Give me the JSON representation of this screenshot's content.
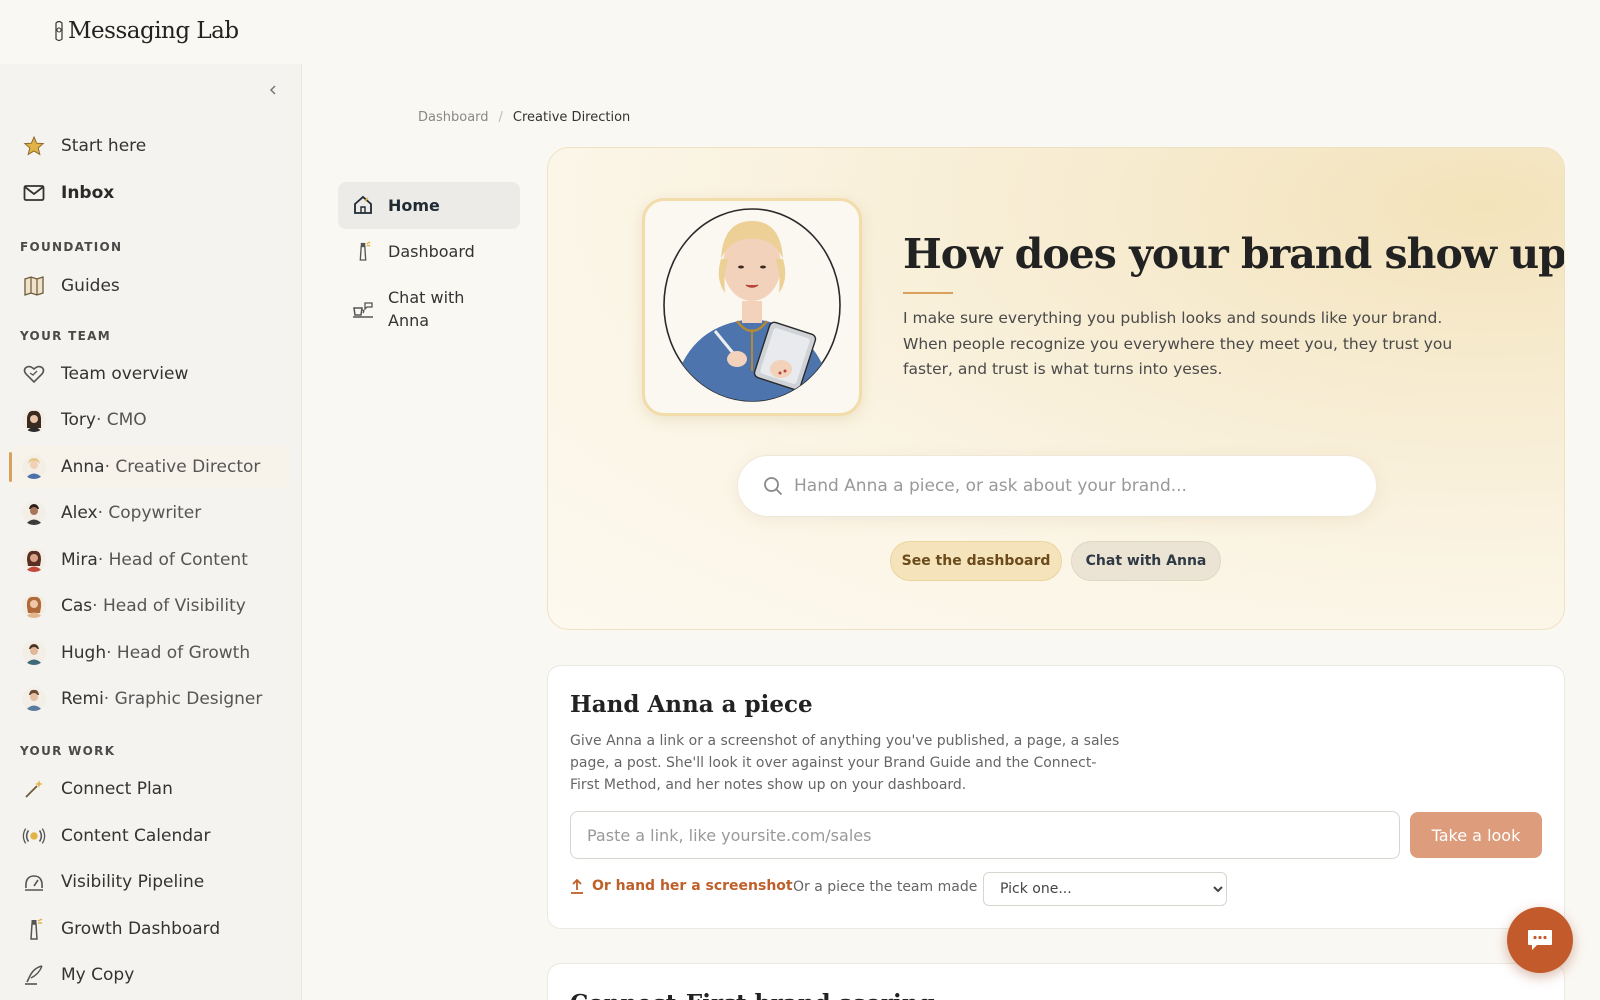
{
  "app": {
    "title": "Messaging Lab"
  },
  "sidebar": {
    "collapse_icon": "chevron-left-icon",
    "top_items": [
      {
        "label": "Start here",
        "icon": "star-icon"
      },
      {
        "label": "Inbox",
        "icon": "envelope-icon"
      }
    ],
    "sections": [
      {
        "title": "FOUNDATION",
        "items": [
          {
            "label": "Guides",
            "icon": "map-icon"
          }
        ]
      },
      {
        "title": "YOUR TEAM",
        "items": [
          {
            "label": "Team overview",
            "icon": "heart-outline-icon"
          },
          {
            "name": "Tory",
            "role": " · CMO",
            "icon": "tory-avatar"
          },
          {
            "name": "Anna",
            "role": " · Creative Director",
            "icon": "anna-avatar",
            "active": true
          },
          {
            "name": "Alex",
            "role": " · Copywriter",
            "icon": "alex-avatar"
          },
          {
            "name": "Mira",
            "role": " · Head of Content",
            "icon": "mira-avatar"
          },
          {
            "name": "Cas",
            "role": " · Head of Visibility",
            "icon": "cas-avatar"
          },
          {
            "name": "Hugh",
            "role": " · Head of Growth",
            "icon": "hugh-avatar"
          },
          {
            "name": "Remi",
            "role": " · Graphic Designer",
            "icon": "remi-avatar"
          }
        ]
      },
      {
        "title": "YOUR WORK",
        "items": [
          {
            "label": "Connect Plan",
            "icon": "sparkle-wand-icon"
          },
          {
            "label": "Content Calendar",
            "icon": "broadcast-icon"
          },
          {
            "label": "Visibility Pipeline",
            "icon": "gauge-icon"
          },
          {
            "label": "Growth Dashboard",
            "icon": "lighthouse-icon"
          },
          {
            "label": "My Copy",
            "icon": "quill-icon"
          }
        ]
      }
    ]
  },
  "breadcrumb": {
    "parent": "Dashboard",
    "separator": "/",
    "current": "Creative Direction"
  },
  "subnav": [
    {
      "label": "Home",
      "icon": "house-icon",
      "active": true
    },
    {
      "label": "Dashboard",
      "icon": "lighthouse-icon"
    },
    {
      "label": "Chat with Anna",
      "icon": "coffee-chat-icon"
    }
  ],
  "hero": {
    "title": "How does your brand show up?",
    "description": "I make sure everything you publish looks and sounds like your brand. When people recognize you everywhere they meet you, they trust you faster, and trust is what turns into yeses.",
    "search_placeholder": "Hand Anna a piece, or ask about your brand...",
    "buttons": {
      "dashboard": "See the dashboard",
      "chat": "Chat with Anna"
    },
    "portrait_icon": "anna-portrait"
  },
  "hand_piece": {
    "title": "Hand Anna a piece",
    "description": "Give Anna a link or a screenshot of anything you've published, a page, a sales page, a post. She'll look it over against your Brand Guide and the Connect-First Method, and her notes show up on your dashboard.",
    "link_placeholder": "Paste a link, like yoursite.com/sales",
    "submit_label": "Take a look",
    "screenshot_label": "Or hand her a screenshot",
    "team_label": "Or a piece the team made",
    "select_value": "Pick one..."
  },
  "next_card": {
    "title": "Connect-First brand scoring"
  },
  "colors": {
    "accent": "#d9a25b",
    "cta": "#dd9c7c",
    "fab": "#c25a2c",
    "link": "#bf5f2a"
  }
}
